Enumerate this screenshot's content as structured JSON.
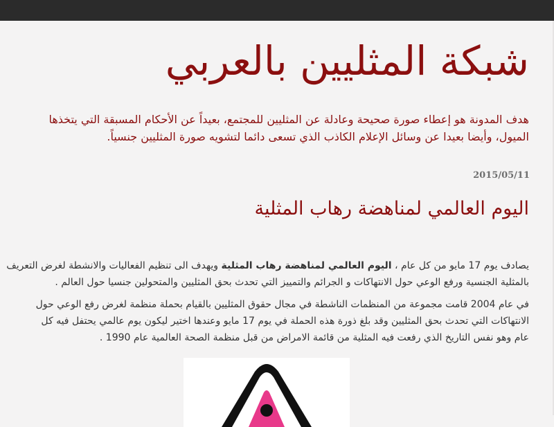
{
  "header": {
    "site_title": "شبكة المثليين بالعربي",
    "description_lines": [
      "هدف المدونة هو إعطاء صورة صحيحة وعادلة عن المثليين للمجتمع، بعيداً عن الأحكام المسبقة التي يتخذها",
      "الميول، وأيضا بعيدا عن وسائل الإعلام الكاذب الذي تسعى دائما لتشويه صورة المثليين جنسياً."
    ]
  },
  "post": {
    "date": "2015/05/11",
    "title": "اليوم العالمي لمناهضة رهاب المثلية",
    "paragraph1": {
      "line1_pre": "يصادف يوم 17 مايو من كل عام ، ",
      "line1_bold": "اليوم العالمي لمناهضة رهاب المثلية",
      "line1_post": " ويهدف الى تنظيم الفعاليات والانشطة لغرض التعريف",
      "line2": "بالمثلية الجنسية ورفع الوعي حول الانتهاكات و الجرائم والتمييز التي تحدث بحق المثليين والمتحولين جنسيا حول العالم ."
    },
    "paragraph2": {
      "lines": [
        "في عام 2004 قامت مجموعة من المنظمات الناشطة في مجال حقوق المثليين بالقيام بحملة منظمة لغرض رفع الوعي حول",
        "الانتهاكات التي تحدث بحق المثليين وقد بلغ ذورة هذه الحملة في يوم 17 مايو وعندها اختير ليكون يوم عالمي يحتفل فيه كل",
        "عام وهو نفس التاريخ الذي رفعت فيه المثلية من قائمة الامراض من قبل منظمة الصحة العالمية عام 1990 ."
      ]
    },
    "image": {
      "icon": "triangle-symbol-icon",
      "colors": {
        "outline": "#111111",
        "inner": "#e8398a",
        "background": "#ffffff"
      }
    }
  }
}
